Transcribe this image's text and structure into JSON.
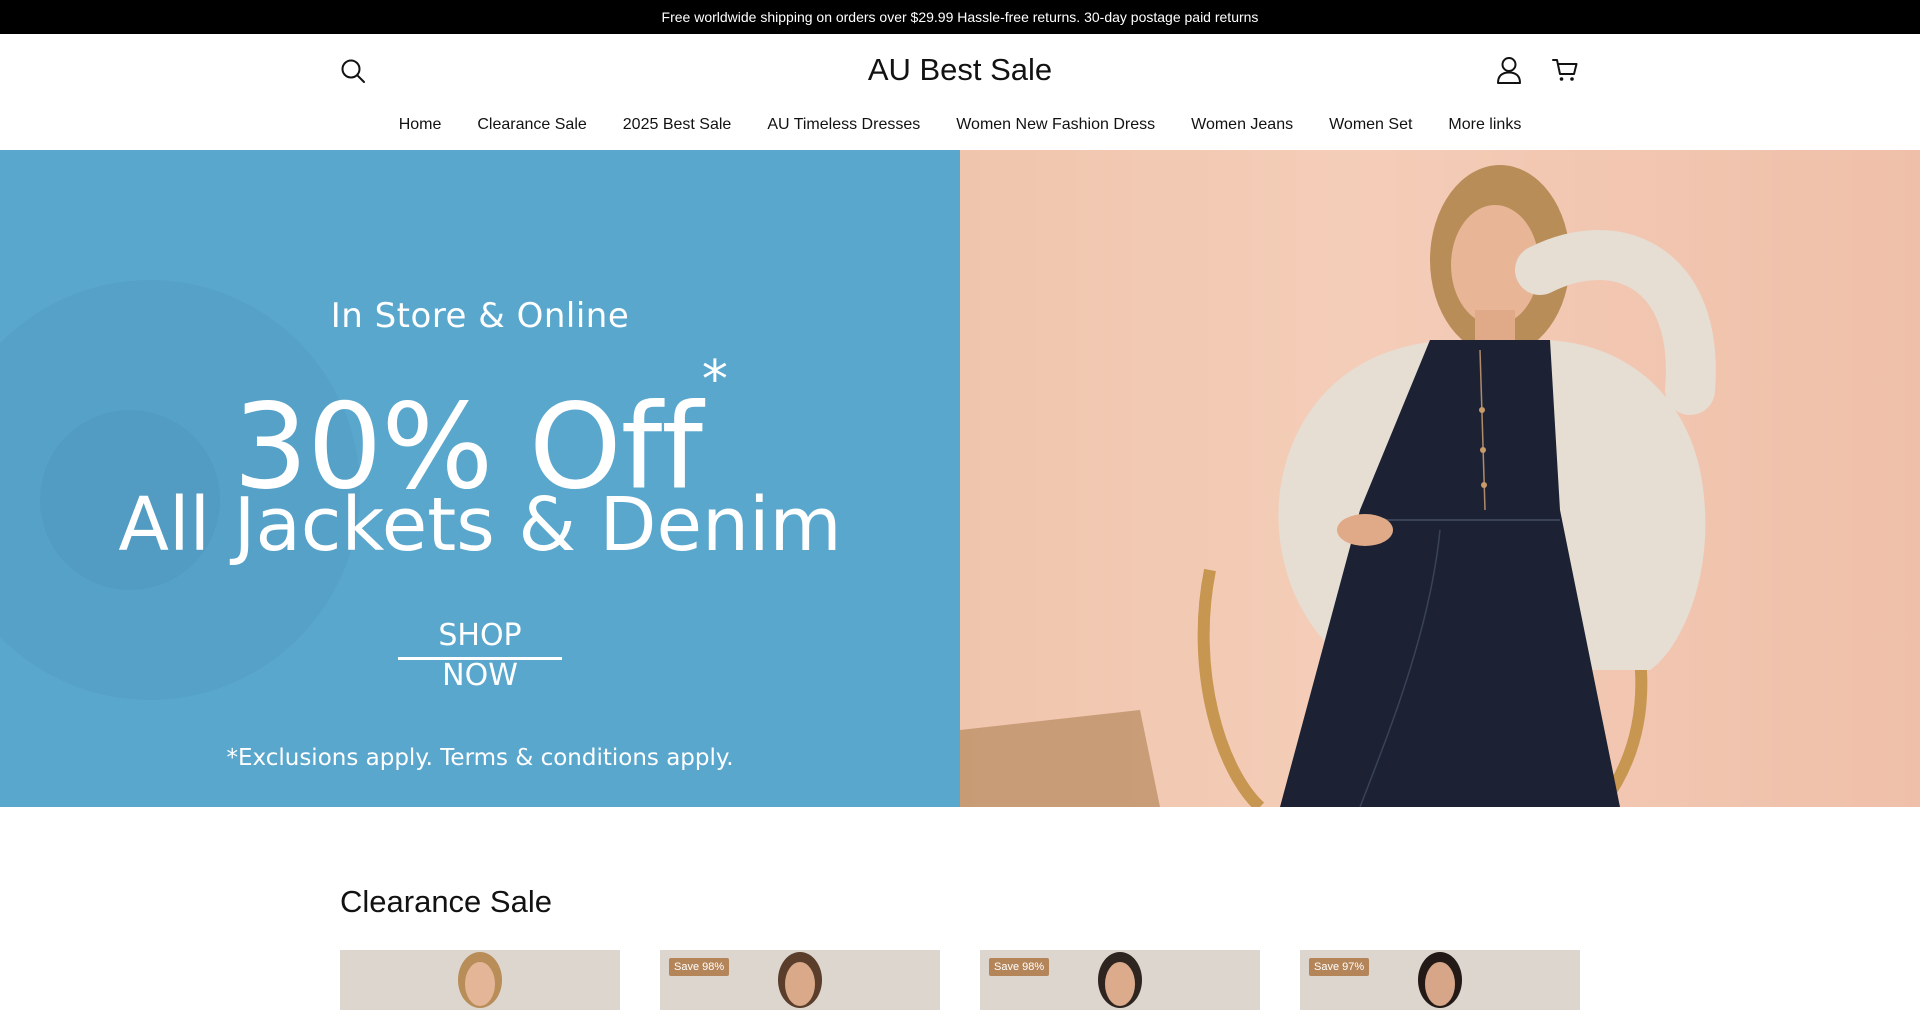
{
  "announcement": "Free worldwide shipping on orders over $29.99 Hassle-free returns. 30-day postage paid returns",
  "header": {
    "logo": "AU Best Sale",
    "icons": {
      "search": "search-icon",
      "account": "account-icon",
      "cart": "cart-icon"
    }
  },
  "nav": [
    {
      "label": "Home"
    },
    {
      "label": "Clearance Sale"
    },
    {
      "label": "2025 Best Sale"
    },
    {
      "label": "AU Timeless Dresses"
    },
    {
      "label": "Women New Fashion Dress"
    },
    {
      "label": "Women Jeans"
    },
    {
      "label": "Women Set"
    },
    {
      "label": "More links"
    }
  ],
  "hero": {
    "eyebrow": "In Store & Online",
    "title": "30% Off",
    "title_mark": "*",
    "subtitle": "All Jackets & Denim",
    "cta": "SHOP NOW",
    "note": "*Exclusions apply. Terms & conditions apply.",
    "colors": {
      "left_bg": "#5aa7cd",
      "right_bg": "#f0c5ad"
    }
  },
  "section": {
    "title": "Clearance Sale",
    "cards": [
      {
        "badge": ""
      },
      {
        "badge": "Save 98%"
      },
      {
        "badge": "Save 98%"
      },
      {
        "badge": "Save 97%"
      }
    ]
  }
}
